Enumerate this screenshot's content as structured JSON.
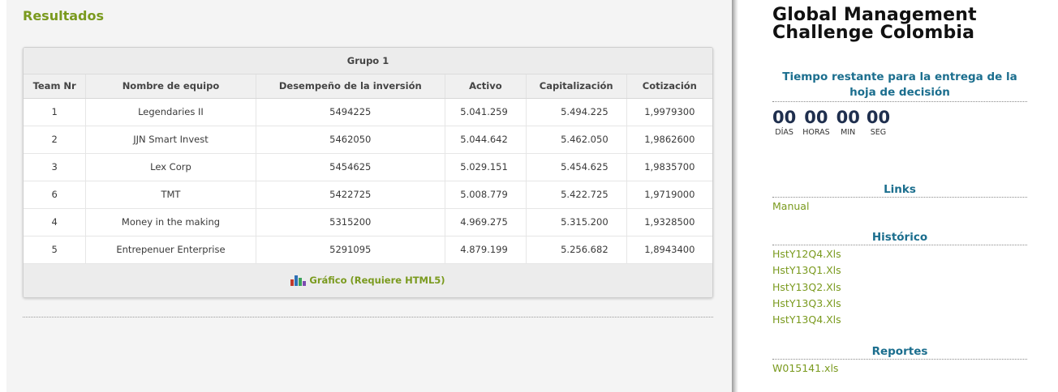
{
  "main": {
    "title": "Resultados",
    "table": {
      "group_label": "Grupo 1",
      "columns": [
        "Team Nr",
        "Nombre de equipo",
        "Desempeño de la inversión",
        "Activo",
        "Capitalización",
        "Cotización"
      ],
      "rows": [
        [
          "1",
          "Legendaries II",
          "5494225",
          "5.041.259",
          "5.494.225",
          "1,9979300"
        ],
        [
          "2",
          "JJN Smart Invest",
          "5462050",
          "5.044.642",
          "5.462.050",
          "1,9862600"
        ],
        [
          "3",
          "Lex Corp",
          "5454625",
          "5.029.151",
          "5.454.625",
          "1,9835700"
        ],
        [
          "6",
          "TMT",
          "5422725",
          "5.008.779",
          "5.422.725",
          "1,9719000"
        ],
        [
          "4",
          "Money in the making",
          "5315200",
          "4.969.275",
          "5.315.200",
          "1,9328500"
        ],
        [
          "5",
          "Entrepenuer Enterprise",
          "5291095",
          "4.879.199",
          "5.256.682",
          "1,8943400"
        ]
      ],
      "chart_link_label": "Gráfico (Requiere HTML5)"
    }
  },
  "sidebar": {
    "brand_line1": "Global Management",
    "brand_line2": "Challenge Colombia",
    "countdown": {
      "title": "Tiempo restante para la entrega de la hoja de decisión",
      "units": [
        {
          "value": "00",
          "label": "DÍAS"
        },
        {
          "value": "00",
          "label": "HORAS"
        },
        {
          "value": "00",
          "label": "MIN"
        },
        {
          "value": "00",
          "label": "SEG"
        }
      ]
    },
    "links_title": "Links",
    "links": [
      "Manual"
    ],
    "historico_title": "Histórico",
    "historico": [
      "HstY12Q4.Xls",
      "HstY13Q1.Xls",
      "HstY13Q2.Xls",
      "HstY13Q3.Xls",
      "HstY13Q4.Xls"
    ],
    "reportes_title": "Reportes",
    "reportes": [
      "W015141.xls"
    ]
  },
  "colors": {
    "accent_green": "#7a9a1e",
    "heading_blue": "#1b6e8e",
    "timer_navy": "#1f2f4e"
  },
  "icons": {
    "chart_link": "bar-chart-icon"
  }
}
